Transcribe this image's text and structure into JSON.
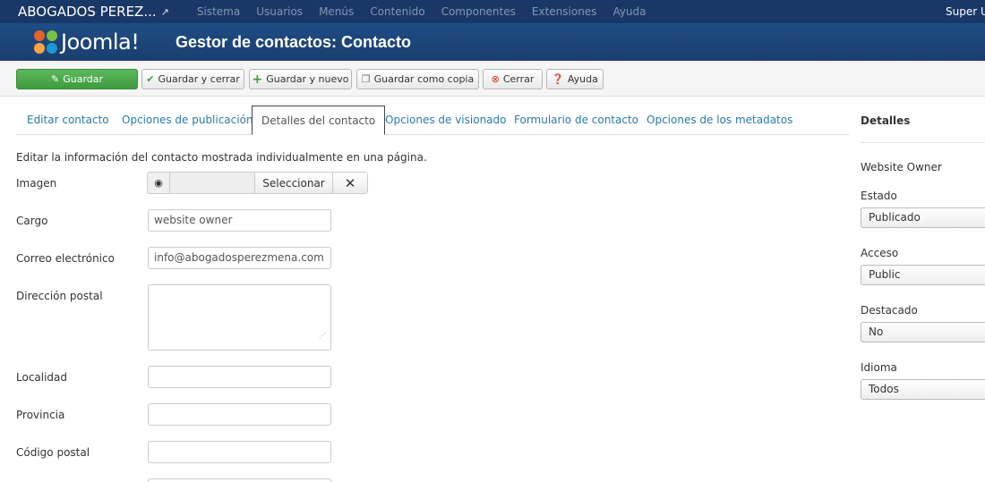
{
  "navbar": {
    "site_name": "ABOGADOS PEREZ...",
    "external_icon": "external-link-icon",
    "menu": [
      "Sistema",
      "Usuarios",
      "Menús",
      "Contenido",
      "Componentes",
      "Extensiones",
      "Ayuda"
    ],
    "user": "Super U"
  },
  "header": {
    "logo_text": "Joomla!",
    "title": "Gestor de contactos: Contacto"
  },
  "toolbar": {
    "save": "Guardar",
    "save_close": "Guardar y cerrar",
    "save_new": "Guardar y nuevo",
    "save_copy": "Guardar como copia",
    "close": "Cerrar",
    "help": "Ayuda"
  },
  "tabs": {
    "edit": "Editar contacto",
    "publishing": "Opciones de publicación",
    "details": "Detalles del contacto",
    "display": "Opciones de visionado",
    "form": "Formulario de contacto",
    "metadata": "Opciones de los metadatos"
  },
  "form": {
    "intro": "Editar la información del contacto mostrada individualmente en una página.",
    "image_label": "Imagen",
    "select_label": "Seleccionar",
    "position_label": "Cargo",
    "position_value": "website owner",
    "email_label": "Correo electrónico",
    "email_value": "info@abogadosperezmena.com",
    "address_label": "Dirección postal",
    "address_value": "",
    "suburb_label": "Localidad",
    "suburb_value": "",
    "state_label": "Provincia",
    "state_value": "",
    "postcode_label": "Código postal",
    "postcode_value": ""
  },
  "side": {
    "title": "Detalles",
    "owner": "Website Owner",
    "state_label": "Estado",
    "state_value": "Publicado",
    "access_label": "Acceso",
    "access_value": "Public",
    "featured_label": "Destacado",
    "featured_value": "No",
    "language_label": "Idioma",
    "language_value": "Todos"
  },
  "colors": {
    "navbar_bg": "#1a3867",
    "header_bg": "#1f4c85",
    "success": "#4cae4c",
    "link": "#2a7aa8"
  }
}
